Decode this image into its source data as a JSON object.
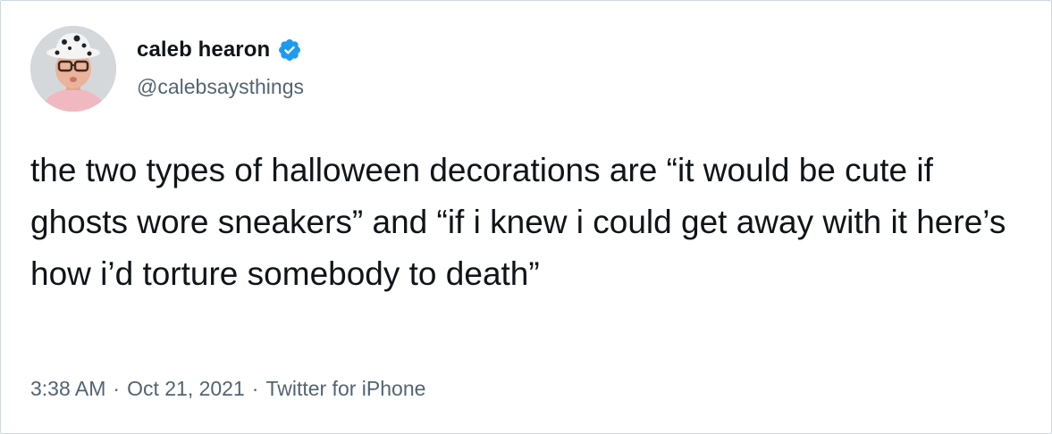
{
  "author": {
    "name": "caleb hearon",
    "handle": "@calebsaysthings",
    "verified": true,
    "verified_color": "#1d9bf0"
  },
  "tweet": {
    "text": "the two types of halloween decorations are “it would be cute if ghosts wore sneakers” and “if i knew i could get away with it here’s how i’d torture somebody to death”"
  },
  "meta": {
    "time": "3:38 AM",
    "separator": "·",
    "date": "Oct 21, 2021",
    "source": "Twitter for iPhone"
  },
  "icons": {
    "verified": "verified-badge-icon",
    "avatar": "profile-photo"
  }
}
